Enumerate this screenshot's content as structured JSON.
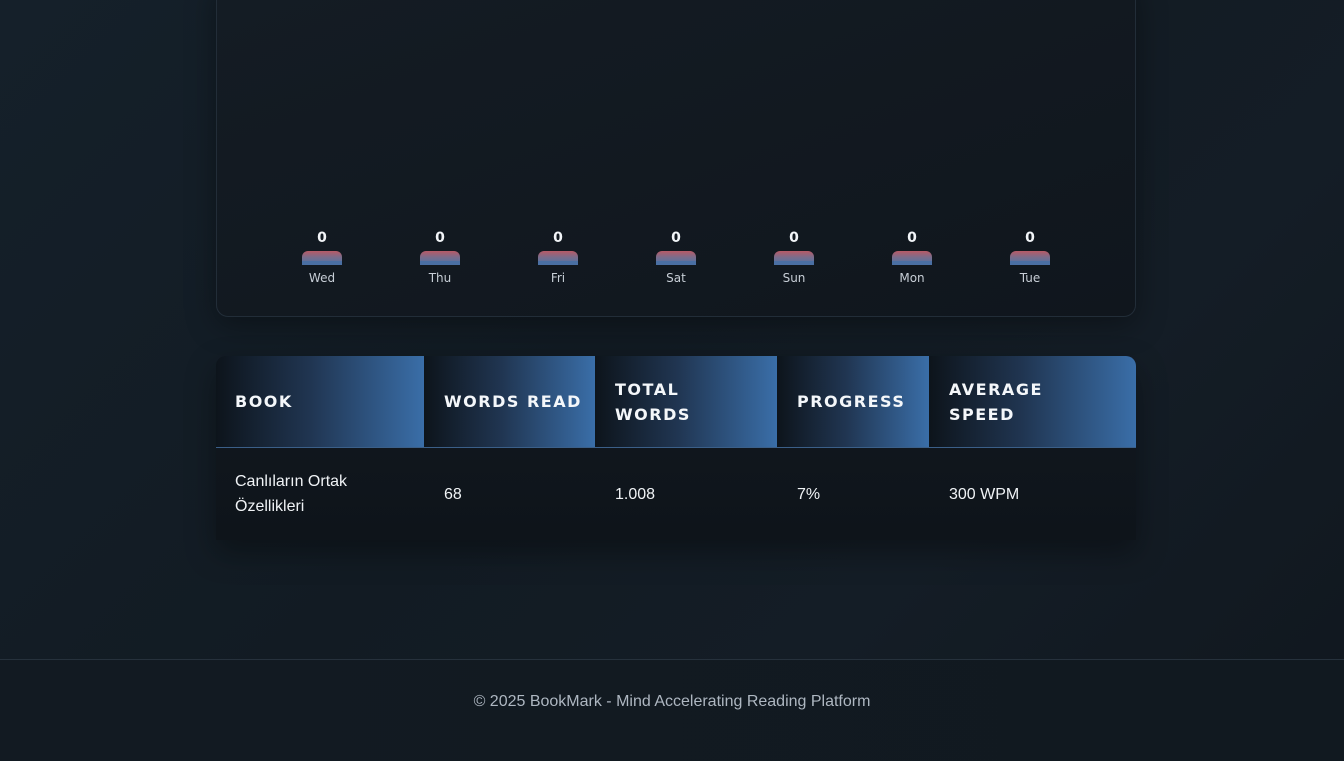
{
  "weekly_chart": {
    "days": [
      {
        "label": "Wed",
        "value": "0"
      },
      {
        "label": "Thu",
        "value": "0"
      },
      {
        "label": "Fri",
        "value": "0"
      },
      {
        "label": "Sat",
        "value": "0"
      },
      {
        "label": "Sun",
        "value": "0"
      },
      {
        "label": "Mon",
        "value": "0"
      },
      {
        "label": "Tue",
        "value": "0"
      }
    ]
  },
  "chart_data": {
    "type": "bar",
    "categories": [
      "Wed",
      "Thu",
      "Fri",
      "Sat",
      "Sun",
      "Mon",
      "Tue"
    ],
    "values": [
      0,
      0,
      0,
      0,
      0,
      0,
      0
    ]
  },
  "reading_table": {
    "headers": [
      "BOOK",
      "WORDS READ",
      "TOTAL WORDS",
      "PROGRESS",
      "AVERAGE SPEED"
    ],
    "rows": [
      [
        "Canlıların Ortak Özellikleri",
        "68",
        "1.008",
        "7%",
        "300 WPM"
      ]
    ]
  },
  "footer": {
    "text": "© 2025 BookMark - Mind Accelerating Reading Platform"
  },
  "colors": {
    "accent": "#3a6ea8",
    "bar_top": "#b85a66",
    "bar_bottom": "#4b73a8"
  }
}
